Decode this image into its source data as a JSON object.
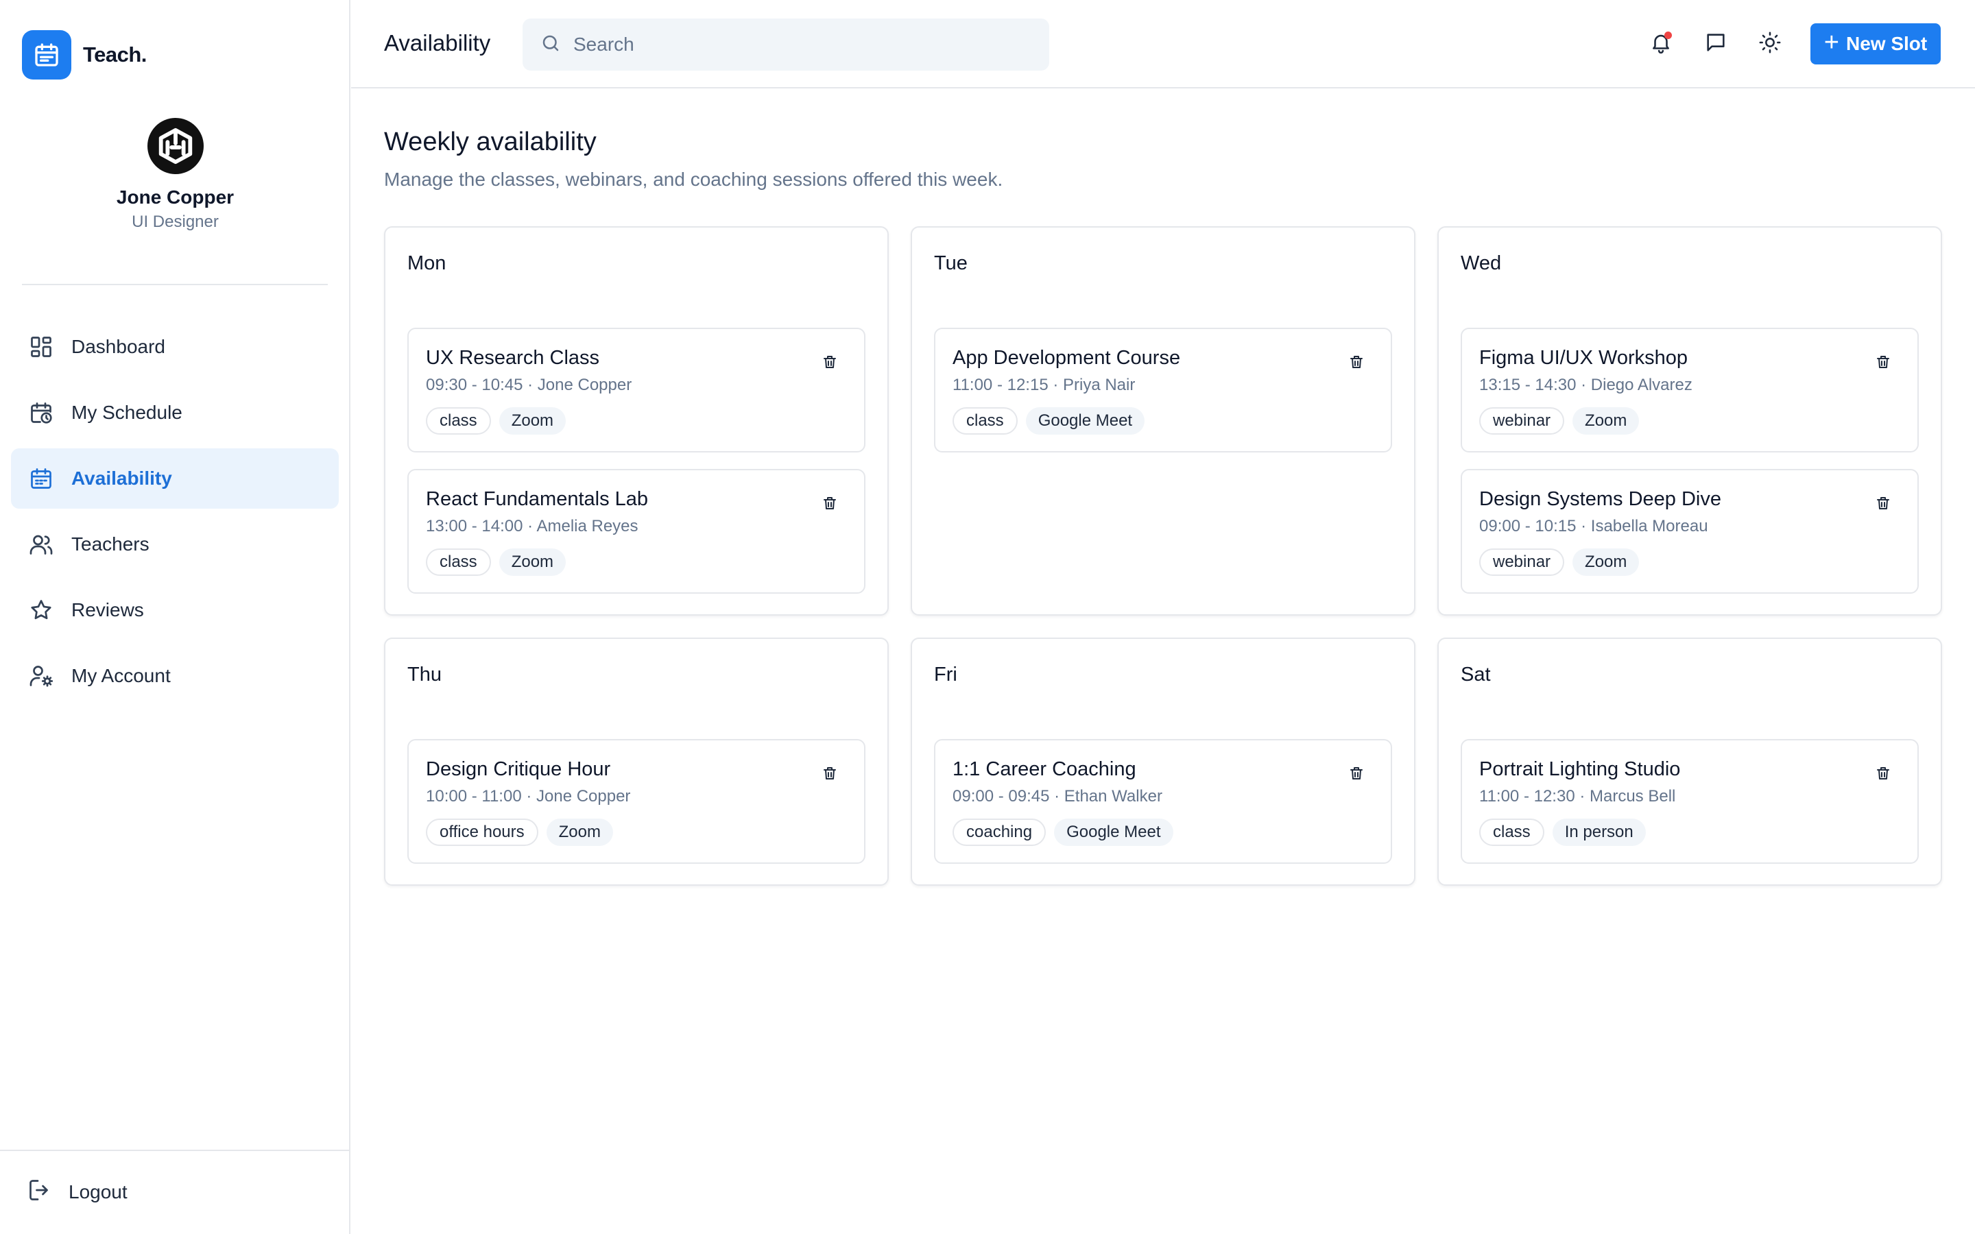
{
  "brand": {
    "name": "Teach.",
    "logo_icon": "calendar-icon",
    "color": "#1d7df0"
  },
  "profile": {
    "name": "Jone Copper",
    "role": "UI Designer"
  },
  "nav": {
    "items": [
      {
        "label": "Dashboard",
        "icon": "grid-icon",
        "active": false
      },
      {
        "label": "My Schedule",
        "icon": "calendar-clock-icon",
        "active": false
      },
      {
        "label": "Availability",
        "icon": "calendar-icon",
        "active": true
      },
      {
        "label": "Teachers",
        "icon": "users-icon",
        "active": false
      },
      {
        "label": "Reviews",
        "icon": "star-icon",
        "active": false
      },
      {
        "label": "My Account",
        "icon": "user-gear-icon",
        "active": false
      }
    ],
    "logout_label": "Logout"
  },
  "topbar": {
    "title": "Availability",
    "search_placeholder": "Search",
    "new_slot_label": "New Slot",
    "icons": [
      "bell-icon",
      "chat-icon",
      "sun-icon"
    ],
    "notification_color": "#ef4444"
  },
  "main": {
    "title": "Weekly availability",
    "subtitle": "Manage the classes, webinars, and coaching sessions offered this week."
  },
  "days": [
    {
      "day": "Mon",
      "slots": [
        {
          "title": "UX Research Class",
          "time": "09:30 - 10:45",
          "teacher": "Jone Copper",
          "type": "class",
          "platform": "Zoom"
        },
        {
          "title": "React Fundamentals Lab",
          "time": "13:00 - 14:00",
          "teacher": "Amelia Reyes",
          "type": "class",
          "platform": "Zoom"
        }
      ]
    },
    {
      "day": "Tue",
      "slots": [
        {
          "title": "App Development Course",
          "time": "11:00 - 12:15",
          "teacher": "Priya Nair",
          "type": "class",
          "platform": "Google Meet"
        }
      ]
    },
    {
      "day": "Wed",
      "slots": [
        {
          "title": "Figma UI/UX Workshop",
          "time": "13:15 - 14:30",
          "teacher": "Diego Alvarez",
          "type": "webinar",
          "platform": "Zoom"
        },
        {
          "title": "Design Systems Deep Dive",
          "time": "09:00 - 10:15",
          "teacher": "Isabella Moreau",
          "type": "webinar",
          "platform": "Zoom"
        }
      ]
    },
    {
      "day": "Thu",
      "slots": [
        {
          "title": "Design Critique Hour",
          "time": "10:00 - 11:00",
          "teacher": "Jone Copper",
          "type": "office hours",
          "platform": "Zoom"
        }
      ]
    },
    {
      "day": "Fri",
      "slots": [
        {
          "title": "1:1 Career Coaching",
          "time": "09:00 - 09:45",
          "teacher": "Ethan Walker",
          "type": "coaching",
          "platform": "Google Meet"
        }
      ]
    },
    {
      "day": "Sat",
      "slots": [
        {
          "title": "Portrait Lighting Studio",
          "time": "11:00 - 12:30",
          "teacher": "Marcus Bell",
          "type": "class",
          "platform": "In person"
        }
      ]
    }
  ]
}
